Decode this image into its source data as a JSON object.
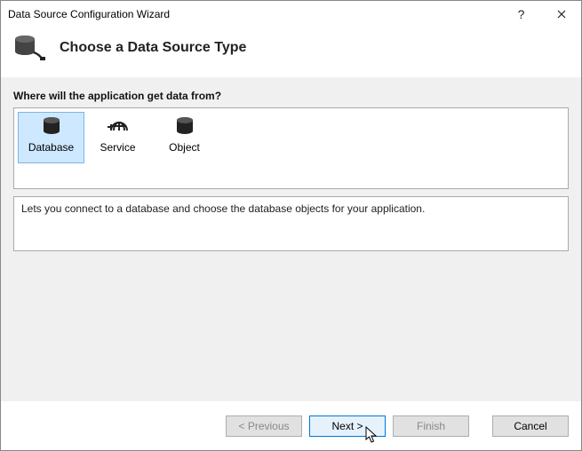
{
  "window": {
    "title": "Data Source Configuration Wizard"
  },
  "header": {
    "heading": "Choose a Data Source Type"
  },
  "prompt": "Where will the application get data from?",
  "types": {
    "database": "Database",
    "service": "Service",
    "object": "Object"
  },
  "description": "Lets you connect to a database and choose the database objects for your application.",
  "buttons": {
    "previous": "< Previous",
    "next": "Next >",
    "finish": "Finish",
    "cancel": "Cancel"
  }
}
